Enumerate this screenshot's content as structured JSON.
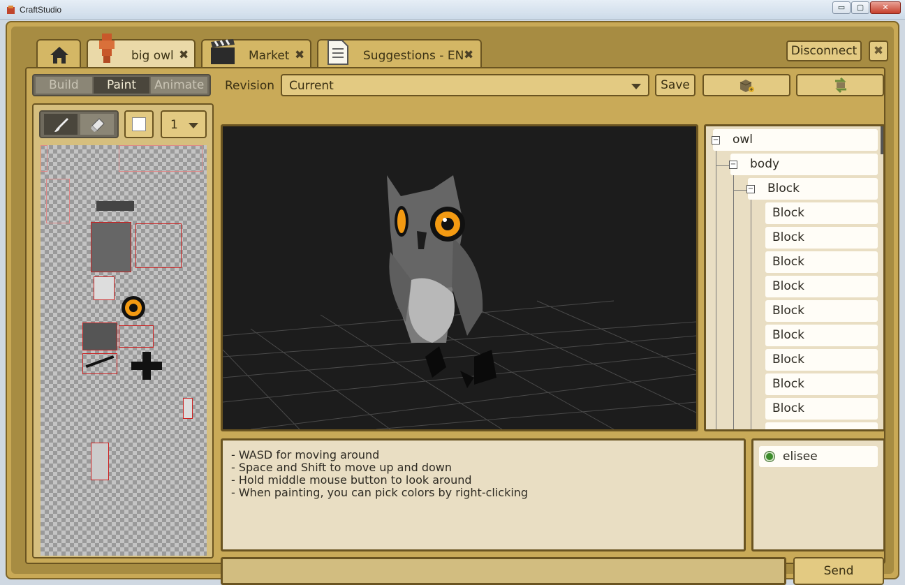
{
  "window": {
    "title": "CraftStudio",
    "min_glyph": "▭",
    "max_glyph": "▢",
    "close_glyph": "✕"
  },
  "tabs": [
    {
      "label": "",
      "icon": "home-icon"
    },
    {
      "label": "big owl",
      "icon": "model-icon",
      "close": "✖",
      "active": true
    },
    {
      "label": "Market",
      "icon": "clapperboard-icon",
      "close": "✖"
    },
    {
      "label": "Suggestions - EN",
      "icon": "document-icon",
      "close": "✖"
    }
  ],
  "top_actions": {
    "disconnect": "Disconnect",
    "close": "✖"
  },
  "modes": [
    "Build",
    "Paint",
    "Animate"
  ],
  "active_mode": "Paint",
  "revision": {
    "label": "Revision",
    "value": "Current",
    "save": "Save"
  },
  "paint": {
    "brush_size": "1",
    "color": "#ffffff"
  },
  "tree": {
    "root": "owl",
    "child": "body",
    "block_parent": "Block",
    "blocks": [
      "Block",
      "Block",
      "Block",
      "Block",
      "Block",
      "Block",
      "Block",
      "Block",
      "Block"
    ]
  },
  "chat": {
    "lines": [
      "- WASD for moving around",
      "- Space and Shift to move up and down",
      "- Hold middle mouse button to look around",
      "- When painting, you can pick colors by right-clicking"
    ],
    "send": "Send",
    "input_value": ""
  },
  "users": [
    {
      "name": "elisee",
      "status": "online"
    }
  ],
  "colors": {
    "frame": "#c9a956",
    "accent_dark": "#6a5421",
    "button": "#e3ca82",
    "eye": "#f39a12",
    "online": "#3b8b2a"
  }
}
